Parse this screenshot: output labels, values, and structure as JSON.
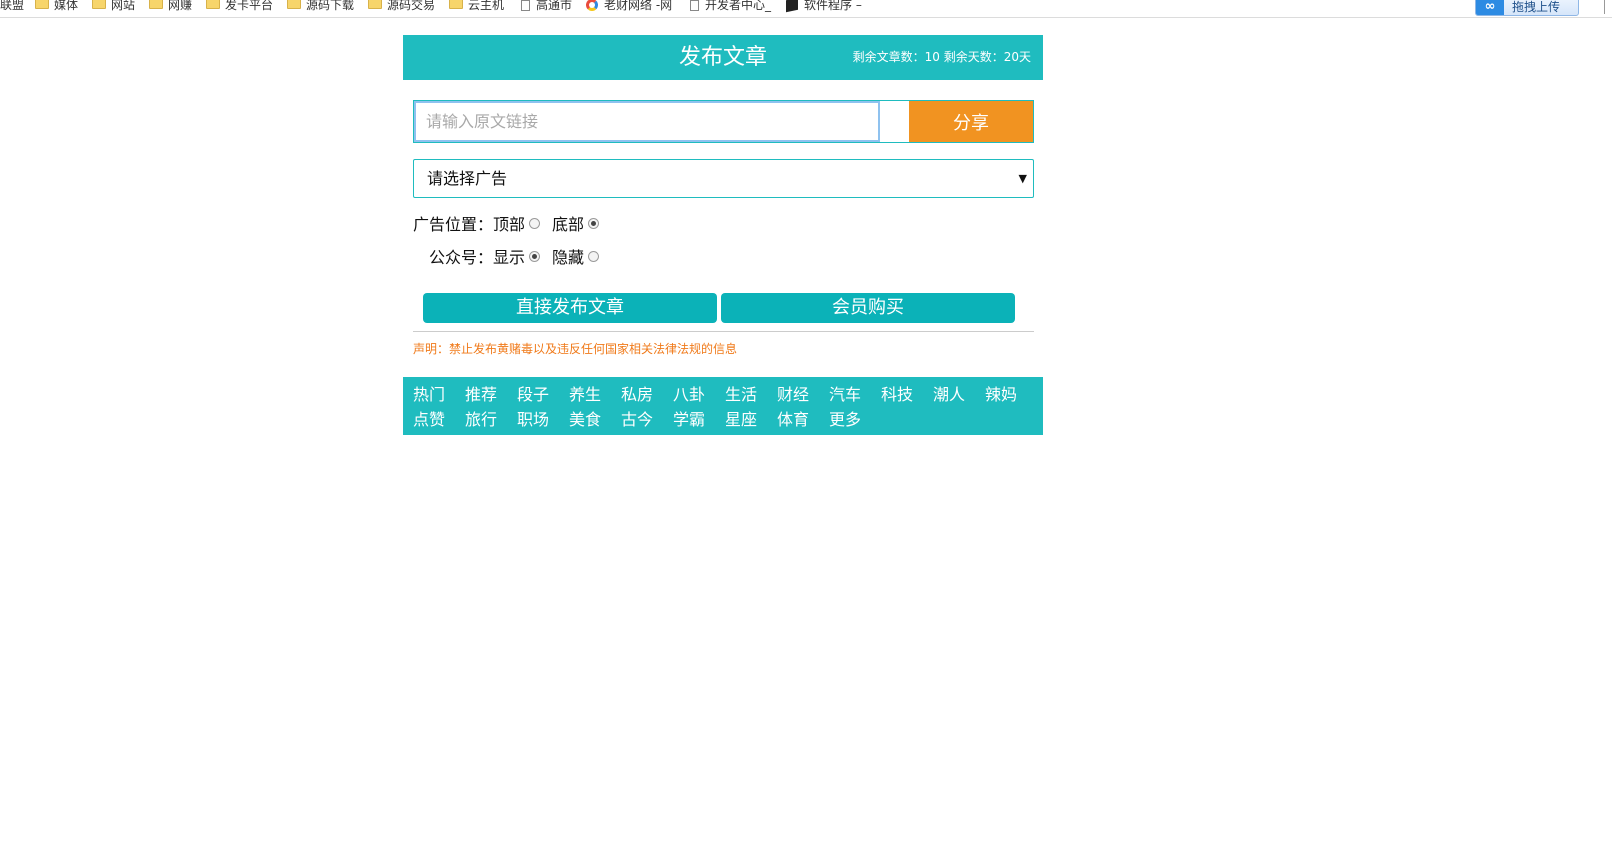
{
  "bookmarks": [
    {
      "label": "联盟",
      "icon": "none"
    },
    {
      "label": "媒体",
      "icon": "folder-icon"
    },
    {
      "label": "网站",
      "icon": "folder-icon"
    },
    {
      "label": "网赚",
      "icon": "folder-icon"
    },
    {
      "label": "发卡平台",
      "icon": "folder-icon"
    },
    {
      "label": "源码下载",
      "icon": "folder-icon"
    },
    {
      "label": "源码交易",
      "icon": "folder-icon"
    },
    {
      "label": "云主机",
      "icon": "folder-icon"
    },
    {
      "label": "高通市",
      "icon": "page-icon"
    },
    {
      "label": "老财网络 -网",
      "icon": "ring-icon"
    },
    {
      "label": "开发者中心_",
      "icon": "page-icon"
    },
    {
      "label": "软件程序 –",
      "icon": "cube-icon"
    }
  ],
  "upload": {
    "label": "拖拽上传",
    "logo": "∞"
  },
  "header": {
    "title": "发布文章",
    "stats": "剩余文章数：10  剩余天数：20天"
  },
  "form": {
    "url_placeholder": "请输入原文链接",
    "url_value": "",
    "share_label": "分享",
    "ad_select_value": "请选择广告",
    "ad_position_label": "广告位置：",
    "ad_position_options": [
      {
        "label": "顶部",
        "checked": false
      },
      {
        "label": "底部",
        "checked": true
      }
    ],
    "account_label": "公众号：",
    "account_options": [
      {
        "label": "显示",
        "checked": true
      },
      {
        "label": "隐藏",
        "checked": false
      }
    ],
    "publish_label": "直接发布文章",
    "buy_label": "会员购买",
    "notice": "声明：禁止发布黄赌毒以及违反任何国家相关法律法规的信息"
  },
  "categories": [
    "热门",
    "推荐",
    "段子",
    "养生",
    "私房",
    "八卦",
    "生活",
    "财经",
    "汽车",
    "科技",
    "潮人",
    "辣妈",
    "点赞",
    "旅行",
    "职场",
    "美食",
    "古今",
    "学霸",
    "星座",
    "体育",
    "更多"
  ],
  "colors": {
    "brand": "#1fbcbf",
    "button": "#0bb2b8",
    "share": "#f19321",
    "notice": "#f07a1a"
  }
}
